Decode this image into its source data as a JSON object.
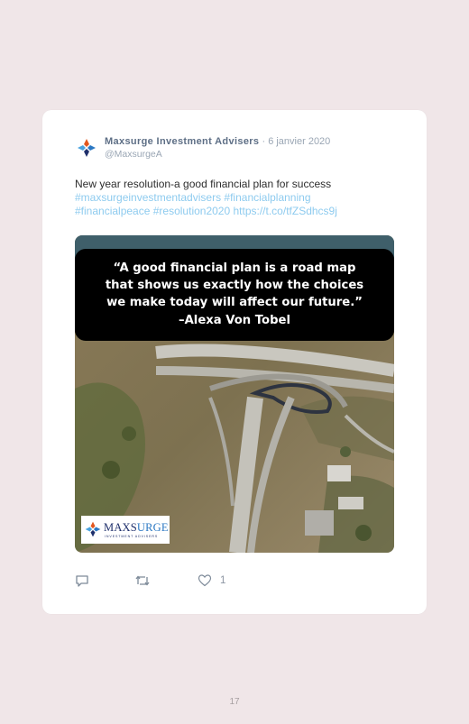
{
  "tweet": {
    "author_name": "Maxsurge Investment Advisers",
    "separator": " · ",
    "date": "6 janvier 2020",
    "handle": "@MaxsurgeA",
    "text_line1": "New year resolution-a good financial plan for success",
    "hashtag1": "#maxsurgeinvestmentadvisers",
    "hashtag2": "#financialplanning",
    "hashtag3": "#financialpeace",
    "hashtag4": "#resolution2020",
    "link": "https://t.co/tfZSdhcs9j",
    "like_count": "1"
  },
  "media": {
    "quote_line1": "“A good financial plan is a road map",
    "quote_line2": "that shows us exactly how the choices",
    "quote_line3": "we make today will affect our future.”",
    "quote_author": "–Alexa Von Tobel",
    "logo_word_main": "MAXS",
    "logo_word_accent": "URGE",
    "logo_sub": "INVESTMENT ADVISERS"
  },
  "footer": {
    "page_number": "17"
  },
  "colors": {
    "page_background": "#f0e6e8",
    "name": "#5e6f86",
    "muted": "#9aa6b4",
    "link": "#8ecbef",
    "logo_navy": "#1e2f6b"
  },
  "icons": [
    "avatar-logo-icon",
    "reply-icon",
    "retweet-icon",
    "heart-icon"
  ]
}
